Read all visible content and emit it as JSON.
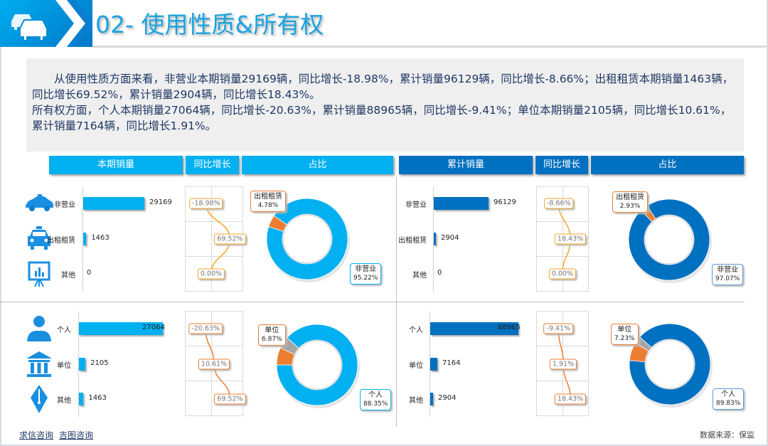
{
  "header": {
    "title": "02- 使用性质&所有权",
    "icon": "cars-icon"
  },
  "summary": {
    "para1": "从使用性质方面来看，非营业本期销量29169辆，同比增长-18.98%，累计销量96129辆，同比增长-8.66%；出租租赁本期销量1463辆，同比增长69.52%，累计销量2904辆，同比增长18.43%。",
    "para2": "所有权方面，个人本期销量27064辆，同比增长-20.63%，累计销量88965辆，同比增长-9.41%；单位本期销量2105辆，同比增长10.61%，累计销量7164辆，同比增长1.91%。"
  },
  "column_headers": {
    "left": [
      "本期销量",
      "同比增长",
      "占比"
    ],
    "right": [
      "累计销量",
      "同比增长",
      "占比"
    ]
  },
  "colors": {
    "left_main": "#00b0f0",
    "right_main": "#0070c0",
    "orange": "#ed7d31",
    "gray": "#a5a5a5",
    "growth_line_top": "#f5a623",
    "growth_line_bottom": "#ed7d31"
  },
  "panels": [
    {
      "name": "usage-current",
      "color": "#00b0f0",
      "rows": [
        {
          "label": "非营业",
          "value": 29169,
          "value_text": "29169",
          "growth": -18.98,
          "growth_text": "-18.98%",
          "icon": "taxi-car-icon"
        },
        {
          "label": "出租租赁",
          "value": 1463,
          "value_text": "1463",
          "growth": 69.52,
          "growth_text": "69.52%",
          "icon": "taxi-icon"
        },
        {
          "label": "其他",
          "value": 0,
          "value_text": "0",
          "growth": 0,
          "growth_text": "0.00%",
          "icon": "presentation-board-icon"
        }
      ],
      "pie": [
        {
          "label": "非营业",
          "pct": 95.22,
          "pct_text": "95.22%",
          "color": "#00b0f0"
        },
        {
          "label": "出租租赁",
          "pct": 4.78,
          "pct_text": "4.78%",
          "color": "#ed7d31"
        }
      ]
    },
    {
      "name": "ownership-current",
      "color": "#00b0f0",
      "rows": [
        {
          "label": "个人",
          "value": 27064,
          "value_text": "27064",
          "growth": -20.63,
          "growth_text": "-20.63%",
          "icon": "person-icon"
        },
        {
          "label": "单位",
          "value": 2105,
          "value_text": "2105",
          "growth": 10.61,
          "growth_text": "10.61%",
          "icon": "institution-icon"
        },
        {
          "label": "其他",
          "value": 1463,
          "value_text": "1463",
          "growth": 69.52,
          "growth_text": "69.52%",
          "icon": "pen-nib-icon"
        }
      ],
      "pie": [
        {
          "label": "个人",
          "pct": 88.35,
          "pct_text": "88.35%",
          "color": "#00b0f0"
        },
        {
          "label": "单位",
          "pct": 6.87,
          "pct_text": "6.87%",
          "color": "#ed7d31"
        },
        {
          "label": "",
          "pct": 4.78,
          "pct_text": "",
          "color": "#a5a5a5"
        }
      ]
    },
    {
      "name": "usage-cumulative",
      "color": "#0070c0",
      "rows": [
        {
          "label": "非营业",
          "value": 96129,
          "value_text": "96129",
          "growth": -8.66,
          "growth_text": "-8.66%"
        },
        {
          "label": "出租租赁",
          "value": 2904,
          "value_text": "2904",
          "growth": 18.43,
          "growth_text": "18.43%"
        },
        {
          "label": "其他",
          "value": 0,
          "value_text": "0",
          "growth": 0,
          "growth_text": "0.00%"
        }
      ],
      "pie": [
        {
          "label": "非营业",
          "pct": 97.07,
          "pct_text": "97.07%",
          "color": "#0070c0"
        },
        {
          "label": "出租租赁",
          "pct": 2.93,
          "pct_text": "2.93%",
          "color": "#ed7d31"
        }
      ]
    },
    {
      "name": "ownership-cumulative",
      "color": "#0070c0",
      "rows": [
        {
          "label": "个人",
          "value": 88965,
          "value_text": "88965",
          "growth": -9.41,
          "growth_text": "-9.41%"
        },
        {
          "label": "单位",
          "value": 7164,
          "value_text": "7164",
          "growth": 1.91,
          "growth_text": "1.91%"
        },
        {
          "label": "其他",
          "value": 2904,
          "value_text": "2904",
          "growth": 18.43,
          "growth_text": "18.43%"
        }
      ],
      "pie": [
        {
          "label": "个人",
          "pct": 89.83,
          "pct_text": "89.83%",
          "color": "#0070c0"
        },
        {
          "label": "单位",
          "pct": 7.23,
          "pct_text": "7.23%",
          "color": "#ed7d31"
        },
        {
          "label": "",
          "pct": 2.94,
          "pct_text": "",
          "color": "#a5a5a5"
        }
      ]
    }
  ],
  "footer": {
    "links": [
      "求信咨询",
      "吉图咨询"
    ],
    "source": "数据来源：保监"
  }
}
